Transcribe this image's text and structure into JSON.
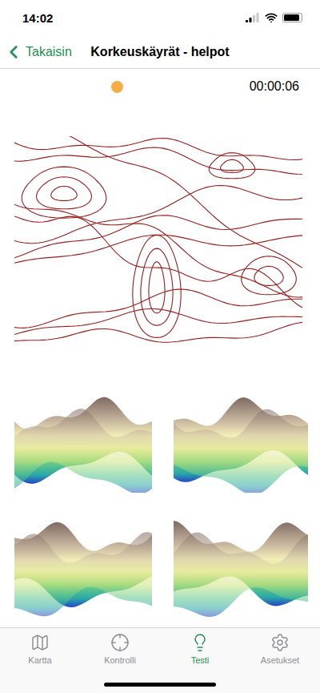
{
  "status_bar": {
    "time": "14:02",
    "battery_level": 0.9
  },
  "nav": {
    "back": "Takaisin",
    "title": "Korkeuskäyrät - helpot"
  },
  "test": {
    "timer": "00:00:06"
  },
  "tab_bar": [
    {
      "label": "Kartta",
      "selected": false
    },
    {
      "label": "Kontrolli",
      "selected": false
    },
    {
      "label": "Testi",
      "selected": true
    },
    {
      "label": "Asetukset",
      "selected": false
    }
  ]
}
